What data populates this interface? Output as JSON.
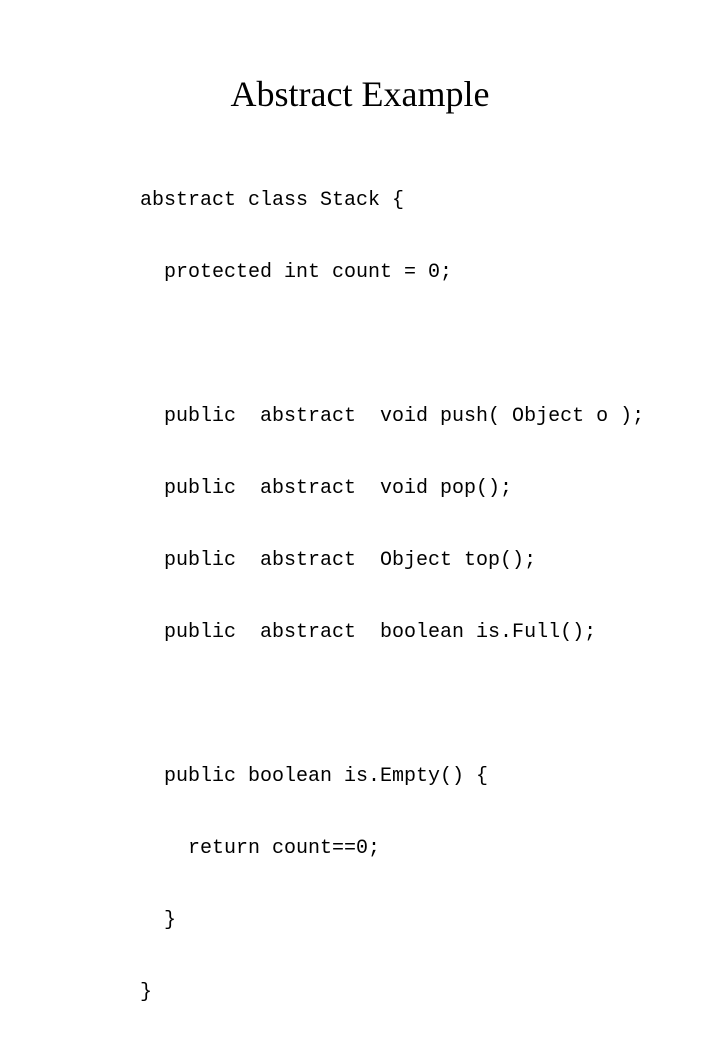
{
  "slide": {
    "title": "Abstract Example",
    "code_lines": [
      "abstract class Stack {",
      "  protected int count = 0;",
      "",
      "  public  abstract  void push( Object o );",
      "  public  abstract  void pop();",
      "  public  abstract  Object top();",
      "  public  abstract  boolean is.Full();",
      "",
      "  public boolean is.Empty() {",
      "    return count==0;",
      "  }",
      "}"
    ]
  }
}
